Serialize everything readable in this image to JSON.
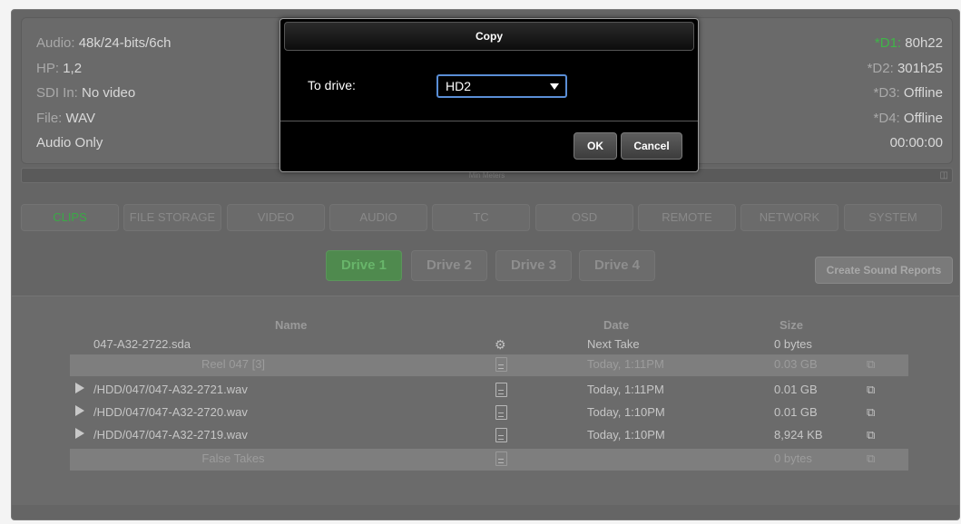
{
  "status": {
    "left": [
      {
        "label": "Audio: ",
        "value": "48k/24-bits/6ch"
      },
      {
        "label": "HP: ",
        "value": "1,2"
      },
      {
        "label": "SDI In: ",
        "value": "No video"
      },
      {
        "label": "File: ",
        "value": "WAV"
      },
      {
        "label": "",
        "value": "Audio Only"
      }
    ],
    "right": [
      {
        "label": "*D1: ",
        "value": "80h22"
      },
      {
        "label": "*D2: ",
        "value": "301h25"
      },
      {
        "label": "*D3: ",
        "value": "Offline"
      },
      {
        "label": "*D4: ",
        "value": "Offline"
      },
      {
        "label": "",
        "value": "00:00:00"
      }
    ]
  },
  "divider_label": "Min Meters",
  "tabs": [
    "CLIPS",
    "FILE STORAGE",
    "VIDEO",
    "AUDIO",
    "TC",
    "OSD",
    "REMOTE",
    "NETWORK",
    "SYSTEM"
  ],
  "drives": [
    "Drive 1",
    "Drive 2",
    "Drive 3",
    "Drive 4"
  ],
  "create_reports_label": "Create Sound Reports",
  "table": {
    "headers": {
      "name": "Name",
      "date": "Date",
      "size": "Size"
    },
    "rows": [
      {
        "name": "047-A32-2722.sda",
        "date": "Next Take",
        "size": "0 bytes"
      },
      {
        "name": "Reel 047 [3]",
        "date": "Today, 1:11PM",
        "size": "0.03 GB"
      },
      {
        "name": "/HDD/047/047-A32-2721.wav",
        "date": "Today, 1:11PM",
        "size": "0.01 GB"
      },
      {
        "name": "/HDD/047/047-A32-2720.wav",
        "date": "Today, 1:10PM",
        "size": "0.01 GB"
      },
      {
        "name": "/HDD/047/047-A32-2719.wav",
        "date": "Today, 1:10PM",
        "size": "8,924 KB"
      },
      {
        "name": "False Takes",
        "date": "",
        "size": "0 bytes"
      }
    ]
  },
  "modal": {
    "title": "Copy",
    "to_drive_label": "To drive:",
    "selected_drive": "HD2",
    "ok_label": "OK",
    "cancel_label": "Cancel"
  },
  "colors": {
    "accent_green": "#3fb548",
    "focus_blue": "#5a8ed6"
  }
}
